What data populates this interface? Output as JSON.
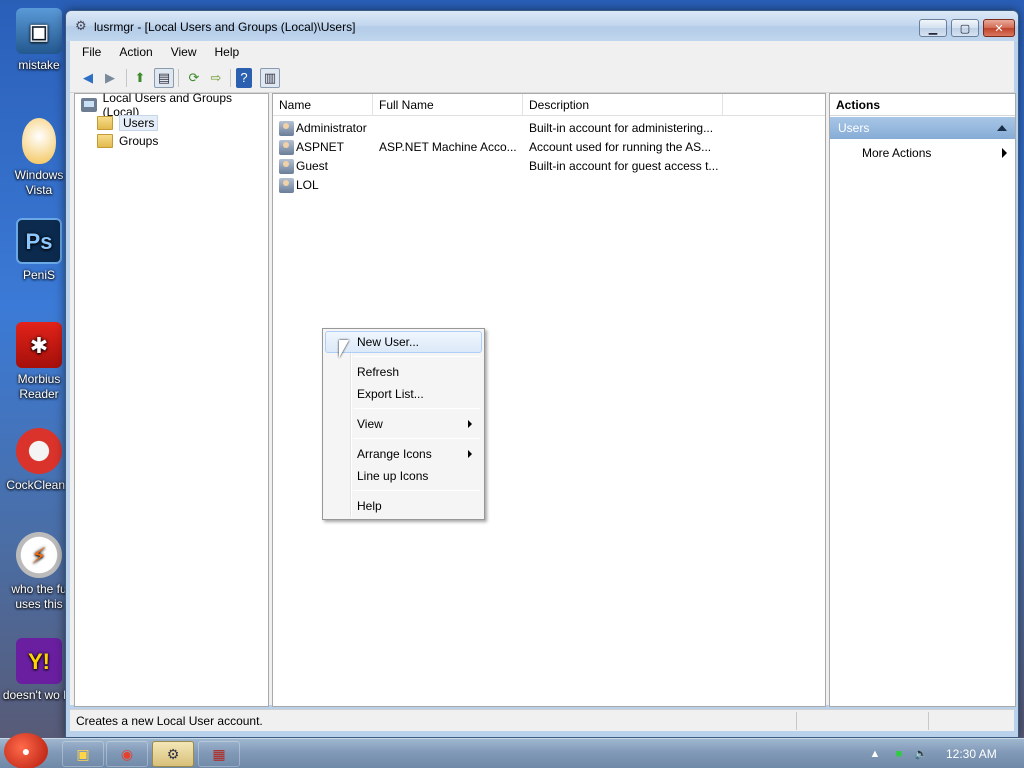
{
  "desktop": {
    "icons": [
      {
        "label": "mistake",
        "icon": "computer-icon"
      },
      {
        "label": "Windows Vista",
        "icon": "vista-egg-icon"
      },
      {
        "label": "PeniS",
        "icon": "photoshop-icon",
        "glyph": "Ps"
      },
      {
        "label": "Morbius Reader",
        "icon": "pdf-reader-icon"
      },
      {
        "label": "CockCleane",
        "icon": "ccleaner-icon"
      },
      {
        "label": "who the fu uses this",
        "icon": "winamp-icon"
      },
      {
        "label": "doesn't wo lol",
        "icon": "yahoo-messenger-icon",
        "glyph": "Y!"
      }
    ]
  },
  "window": {
    "title": "lusrmgr - [Local Users and Groups (Local)\\Users]",
    "menu": [
      "File",
      "Action",
      "View",
      "Help"
    ],
    "toolbar": [
      "back-icon",
      "forward-icon",
      "up-folder-icon",
      "show-tree-icon",
      "refresh-icon",
      "export-icon",
      "help-icon",
      "action-pane-icon"
    ]
  },
  "tree": {
    "root": "Local Users and Groups (Local)",
    "children": [
      {
        "label": "Users",
        "selected": true
      },
      {
        "label": "Groups",
        "selected": false
      }
    ]
  },
  "list": {
    "columns": [
      "Name",
      "Full Name",
      "Description"
    ],
    "rows": [
      {
        "name": "Administrator",
        "full_name": "",
        "description": "Built-in account for administering..."
      },
      {
        "name": "ASPNET",
        "full_name": "ASP.NET Machine Acco...",
        "description": "Account used for running the AS..."
      },
      {
        "name": "Guest",
        "full_name": "",
        "description": "Built-in account for guest access t..."
      },
      {
        "name": "LOL",
        "full_name": "",
        "description": ""
      }
    ]
  },
  "actions": {
    "header": "Actions",
    "section": "Users",
    "items": [
      "More Actions"
    ]
  },
  "context_menu": {
    "items": [
      "New User...",
      "Refresh",
      "Export List...",
      "View",
      "Arrange Icons",
      "Line up Icons",
      "Help"
    ]
  },
  "status": {
    "text": "Creates a new Local User account."
  },
  "taskbar": {
    "clock": "12:30 AM"
  }
}
